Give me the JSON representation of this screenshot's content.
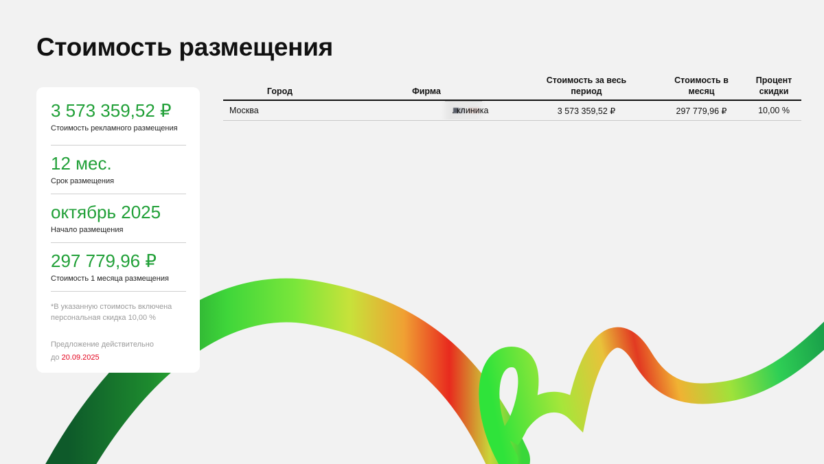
{
  "title": "Стоимость размещения",
  "summary": {
    "stats": [
      {
        "value": "3 573 359,52 ₽",
        "label": "Стоимость рекламного размещения"
      },
      {
        "value": "12 мес.",
        "label": "Срок размещения"
      },
      {
        "value": "октябрь 2025",
        "label": "Начало размещения"
      },
      {
        "value": "297 779,96 ₽",
        "label": "Стоимость 1 месяца размещения"
      }
    ],
    "note_line1": "*В указанную стоимость включена",
    "note_line2": "персональная скидка 10,00 %",
    "offer_line1": "Предложение действительно",
    "offer_prefix": "до ",
    "offer_date": "20.09.2025"
  },
  "table": {
    "headers": {
      "city": "Город",
      "firm": "Фирма",
      "total_line1": "Стоимость за весь",
      "total_line2": "период",
      "month_line1": "Стоимость в",
      "month_line2": "месяц",
      "discount_line1": "Процент",
      "discount_line2": "скидки"
    },
    "rows": [
      {
        "city": "Москва",
        "firm": ". клиника",
        "total": "3 573 359,52 ₽",
        "month": "297 779,96 ₽",
        "discount": "10,00 %"
      }
    ]
  },
  "colors": {
    "accent_green": "#21a038",
    "date_red": "#e3001b",
    "background": "#f2f2f2",
    "card": "#ffffff"
  }
}
